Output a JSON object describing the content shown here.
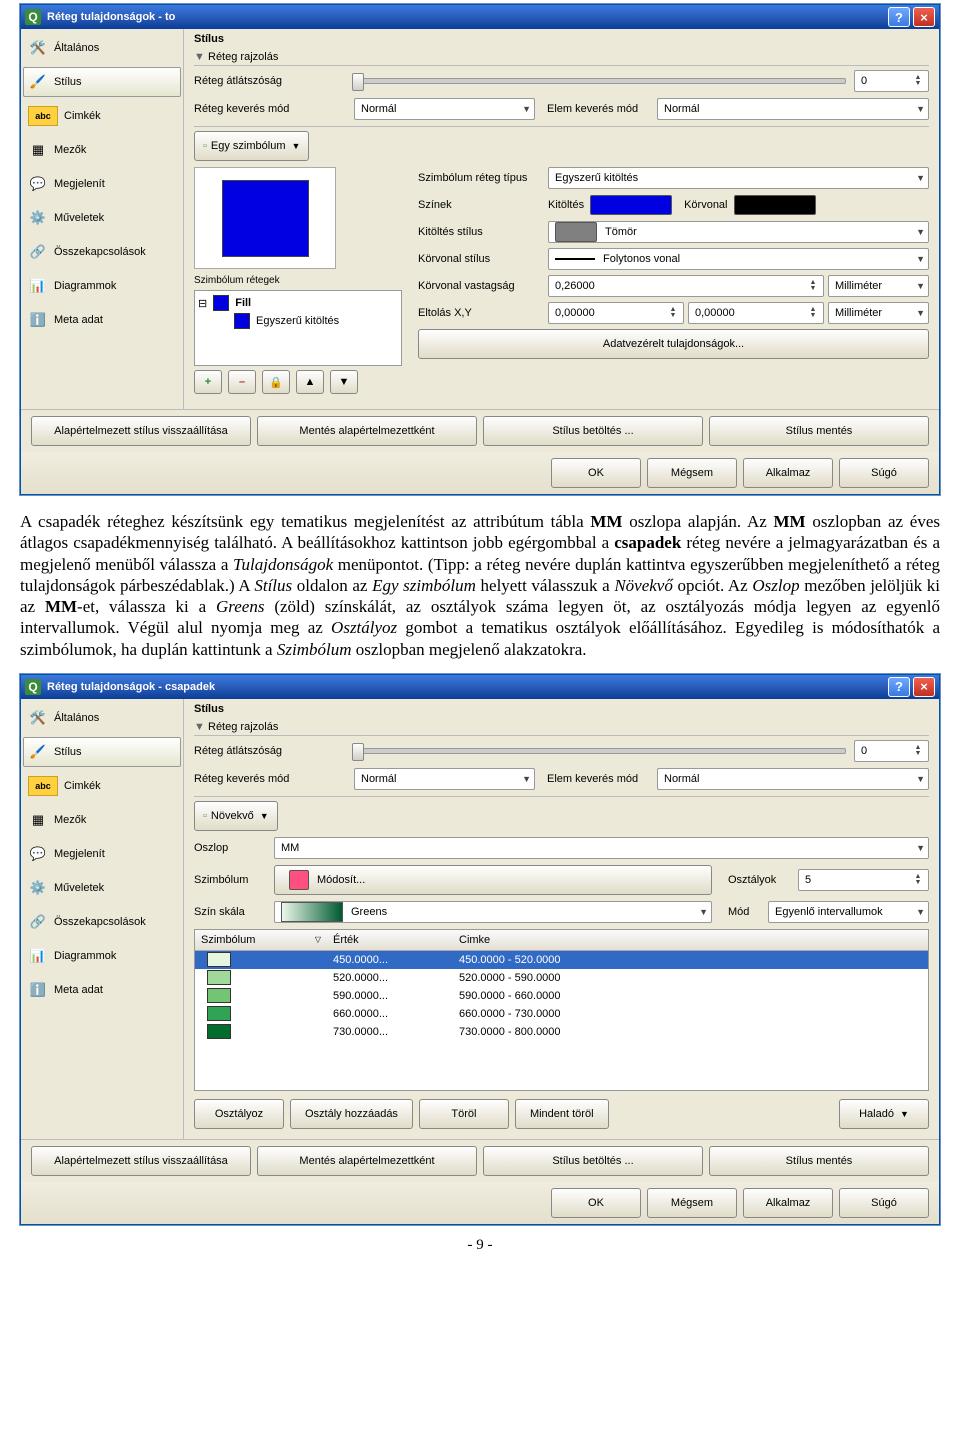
{
  "dialog1": {
    "title": "Réteg tulajdonságok - to",
    "sidebar": [
      {
        "label": "Általános"
      },
      {
        "label": "Stílus"
      },
      {
        "label": "Cimkék"
      },
      {
        "label": "Mezők"
      },
      {
        "label": "Megjelenít"
      },
      {
        "label": "Műveletek"
      },
      {
        "label": "Összekapcsolások"
      },
      {
        "label": "Diagrammok"
      },
      {
        "label": "Meta adat"
      }
    ],
    "section_title": "Stílus",
    "drawing_label": "Réteg rajzolás",
    "opacity_label": "Réteg átlátszóság",
    "opacity_value": "0",
    "blend_layer_label": "Réteg keverés mód",
    "blend_layer_value": "Normál",
    "blend_elem_label": "Elem keverés mód",
    "blend_elem_value": "Normál",
    "symbol_mode_btn": "Egy szimbólum",
    "sym_layers_label": "Szimbólum rétegek",
    "tree_root": "Fill",
    "tree_child": "Egyszerű kitöltés",
    "sym_type_label": "Szimbólum réteg típus",
    "sym_type_value": "Egyszerű kitöltés",
    "colors_label": "Színek",
    "fill_label": "Kitöltés",
    "outline_label": "Körvonal",
    "fill_style_label": "Kitöltés stílus",
    "fill_style_value": "Tömör",
    "outline_style_label": "Körvonal stílus",
    "outline_style_value": "Folytonos vonal",
    "outline_width_label": "Körvonal vastagság",
    "outline_width_value": "0,26000",
    "unit": "Milliméter",
    "offset_label": "Eltolás X,Y",
    "offset_x": "0,00000",
    "offset_y": "0,00000",
    "dd_props_btn": "Adatvezérelt tulajdonságok...",
    "bottom_buttons": [
      "Alapértelmezett stílus visszaállítása",
      "Mentés alapértelmezettként",
      "Stílus betöltés ...",
      "Stílus mentés"
    ],
    "footer": [
      "OK",
      "Mégsem",
      "Alkalmaz",
      "Súgó"
    ]
  },
  "paragraph": {
    "s1": "A csapadék réteghez készítsünk egy tematikus megjelenítést az attribútum tábla ",
    "b1": "MM",
    "s2": " oszlopa alapján. Az ",
    "b2": "MM",
    "s3": " oszlopban az éves átlagos csapadékmennyiség található. A beállításokhoz kattintson jobb egérgombbal a ",
    "b3": "csapadek",
    "s4": " réteg nevére a jelmagyarázatban és a megjelenő menüből válassza a ",
    "i1": "Tulajdonságok",
    "s5": " menüpontot. (Tipp: a réteg nevére duplán kattintva egyszerűbben megjeleníthető a réteg tulajdonságok párbeszédablak.) A ",
    "i2": "Stílus",
    "s6": " oldalon az ",
    "i3": "Egy szimbólum",
    "s7": " helyett válasszuk a ",
    "i4": "Növekvő",
    "s8": " opciót. Az ",
    "i5": "Oszlop",
    "s9": " mezőben jelöljük ki az ",
    "b4": "MM",
    "s10": "-et, válassza ki a ",
    "i6": "Greens",
    "s11": " (zöld) színskálát, az osztályok száma legyen öt, az osztályozás módja legyen az egyenlő intervallumok. Végül alul nyomja meg az ",
    "i7": "Osztályoz",
    "s12": " gombot a tematikus osztályok előállításához. Egyedileg is módosíthatók a szimbólumok, ha duplán kattintunk a ",
    "i8": "Szimbólum",
    "s13": " oszlopban megjelenő alakzatokra."
  },
  "dialog2": {
    "title": "Réteg tulajdonságok - csapadek",
    "symbol_mode_btn": "Növekvő",
    "column_label": "Oszlop",
    "column_value": "MM",
    "symbol_label": "Szimbólum",
    "modify_btn": "Módosít...",
    "classes_label": "Osztályok",
    "classes_value": "5",
    "ramp_label": "Szín skála",
    "ramp_value": "Greens",
    "mode_label": "Mód",
    "mode_value": "Egyenlő intervallumok",
    "table_headers": [
      "Szimbólum",
      "Érték",
      "Cimke"
    ],
    "rows": [
      {
        "color": "#e5f5e0",
        "value": "450.0000...",
        "label": "450.0000 - 520.0000"
      },
      {
        "color": "#a1d99b",
        "value": "520.0000...",
        "label": "520.0000 - 590.0000"
      },
      {
        "color": "#74c476",
        "value": "590.0000...",
        "label": "590.0000 - 660.0000"
      },
      {
        "color": "#31a354",
        "value": "660.0000...",
        "label": "660.0000 - 730.0000"
      },
      {
        "color": "#006d2c",
        "value": "730.0000...",
        "label": "730.0000 - 800.0000"
      }
    ],
    "class_buttons": [
      "Osztályoz",
      "Osztály hozzáadás",
      "Töröl",
      "Mindent töröl"
    ],
    "advanced_btn": "Haladó"
  },
  "page_number": "- 9 -"
}
